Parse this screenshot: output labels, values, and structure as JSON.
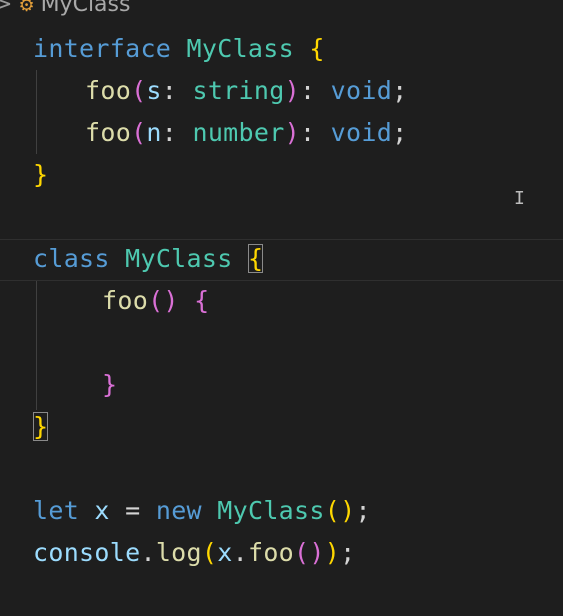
{
  "breadcrumb": {
    "separator": ">",
    "icon": "class-icon",
    "label": "MyClass"
  },
  "code": {
    "lines": [
      "interface MyClass {",
      "foo(s: string): void;",
      "foo(n: number): void;",
      "}",
      "",
      "class MyClass {",
      "foo() {",
      "",
      "}",
      "}",
      "",
      "let x = new MyClass();",
      "console.log(x.foo());"
    ]
  },
  "tokens": {
    "interface": "interface",
    "class": "class",
    "let": "let",
    "new": "new",
    "void": "void",
    "MyClass": "MyClass",
    "foo": "foo",
    "s": "s",
    "n": "n",
    "string": "string",
    "number": "number",
    "x": "x",
    "console": "console",
    "log": "log"
  },
  "colors": {
    "background": "#1e1e1e",
    "keyword": "#569cd6",
    "type": "#4ec9b0",
    "function": "#dcdcaa",
    "parameter": "#9cdcfe",
    "bracket_level1": "#ffd700",
    "bracket_level2": "#da70d6",
    "bracket_level3": "#179fff"
  }
}
